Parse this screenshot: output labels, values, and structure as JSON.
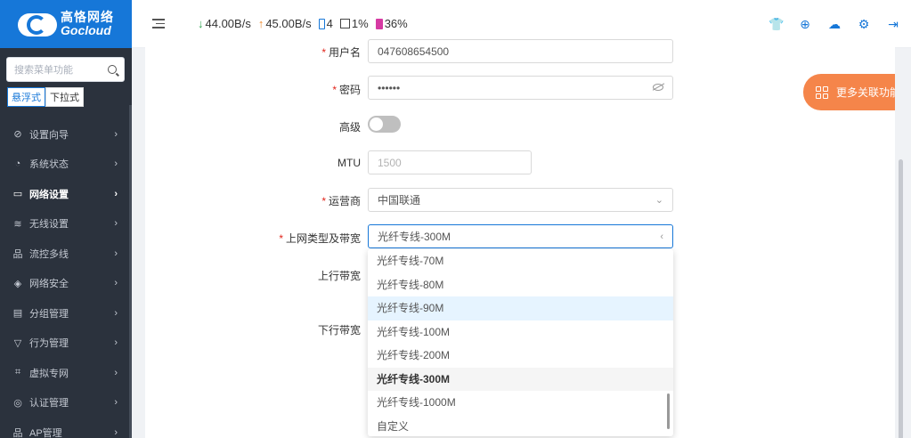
{
  "brand": {
    "name_cn": "高恪网络",
    "name_en": "Gocloud"
  },
  "sidebar": {
    "search_placeholder": "搜索菜单功能",
    "modes": [
      "悬浮式",
      "下拉式"
    ],
    "items": [
      {
        "label": "设置向导",
        "icon": "compass-icon",
        "glyph": "⊘"
      },
      {
        "label": "系统状态",
        "icon": "gauge-icon",
        "glyph": "◔"
      },
      {
        "label": "网络设置",
        "icon": "monitor-icon",
        "glyph": "▭"
      },
      {
        "label": "无线设置",
        "icon": "wifi-icon",
        "glyph": "≋"
      },
      {
        "label": "流控多线",
        "icon": "network-icon",
        "glyph": "品"
      },
      {
        "label": "网络安全",
        "icon": "shield-icon",
        "glyph": "◈"
      },
      {
        "label": "分组管理",
        "icon": "list-icon",
        "glyph": "▤"
      },
      {
        "label": "行为管理",
        "icon": "filter-icon",
        "glyph": "▽"
      },
      {
        "label": "虚拟专网",
        "icon": "vpn-icon",
        "glyph": "⌗"
      },
      {
        "label": "认证管理",
        "icon": "check-shield-icon",
        "glyph": "◎"
      },
      {
        "label": "AP管理",
        "icon": "ap-icon",
        "glyph": "品"
      }
    ]
  },
  "topbar": {
    "download": "44.00B/s",
    "upload": "45.00B/s",
    "sim": "4",
    "cpu": "1%",
    "memory": "36%",
    "icons": [
      "shirt-icon",
      "globe-icon",
      "cloud-upload-icon",
      "gear-icon",
      "logout-icon"
    ],
    "icon_glyphs": [
      "👕",
      "⊕",
      "☁",
      "⚙",
      "⇥"
    ],
    "accent": "#1677d8"
  },
  "form": {
    "username_label": "用户名",
    "username_value": "047608654500",
    "password_label": "密码",
    "password_value": "••••••",
    "advanced_label": "高级",
    "mtu_label": "MTU",
    "mtu_placeholder": "1500",
    "isp_label": "运营商",
    "isp_value": "中国联通",
    "bandwidth_label": "上网类型及带宽",
    "bandwidth_value": "光纤专线-300M",
    "upstream_label": "上行带宽",
    "downstream_label": "下行带宽"
  },
  "dropdown": {
    "options": [
      "光纤专线-70M",
      "光纤专线-80M",
      "光纤专线-90M",
      "光纤专线-100M",
      "光纤专线-200M",
      "光纤专线-300M",
      "光纤专线-1000M",
      "自定义"
    ],
    "hovered": "光纤专线-90M",
    "selected": "光纤专线-300M"
  },
  "more_button": {
    "label": "更多关联功能",
    "color": "#f5854a"
  }
}
